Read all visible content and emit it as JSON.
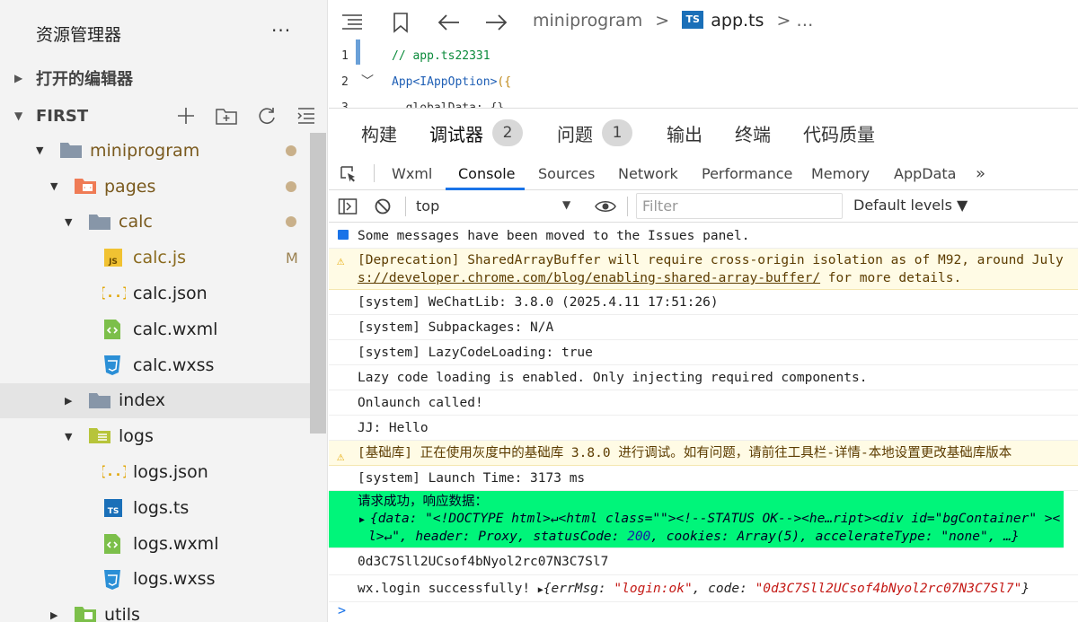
{
  "sidebar": {
    "title": "资源管理器",
    "more": "···",
    "open_editors": "打开的编辑器",
    "project": "FIRST",
    "tree": [
      {
        "name": "miniprogram",
        "type": "folder",
        "marker": "dot"
      },
      {
        "name": "pages",
        "type": "folder-pages",
        "marker": "dot"
      },
      {
        "name": "calc",
        "type": "folder",
        "marker": "dot"
      },
      {
        "name": "calc.js",
        "type": "js",
        "marker": "M"
      },
      {
        "name": "calc.json",
        "type": "json",
        "marker": ""
      },
      {
        "name": "calc.wxml",
        "type": "wxml",
        "marker": ""
      },
      {
        "name": "calc.wxss",
        "type": "wxss",
        "marker": ""
      },
      {
        "name": "index",
        "type": "folder",
        "marker": ""
      },
      {
        "name": "logs",
        "type": "folder-logs",
        "marker": ""
      },
      {
        "name": "logs.json",
        "type": "json",
        "marker": ""
      },
      {
        "name": "logs.ts",
        "type": "ts",
        "marker": ""
      },
      {
        "name": "logs.wxml",
        "type": "wxml",
        "marker": ""
      },
      {
        "name": "logs.wxss",
        "type": "wxss",
        "marker": ""
      },
      {
        "name": "utils",
        "type": "folder-utils",
        "marker": ""
      }
    ]
  },
  "editor": {
    "breadcrumb_folder": "miniprogram",
    "breadcrumb_sep": ">",
    "breadcrumb_file": "app.ts",
    "breadcrumb_more": "> …",
    "ts_badge": "TS",
    "lines": [
      {
        "num": "1",
        "comment": "// app.ts22331"
      },
      {
        "num": "2",
        "kw": "App",
        "type": "<IAppOption>",
        "rest": "({"
      },
      {
        "num": "3",
        "text": "  globalData: {},"
      }
    ]
  },
  "devtools": {
    "panel_tabs": [
      {
        "label": "构建",
        "badge": ""
      },
      {
        "label": "调试器",
        "badge": "2"
      },
      {
        "label": "问题",
        "badge": "1"
      },
      {
        "label": "输出",
        "badge": ""
      },
      {
        "label": "终端",
        "badge": ""
      },
      {
        "label": "代码质量",
        "badge": ""
      }
    ],
    "tool_tabs": [
      "Wxml",
      "Console",
      "Sources",
      "Network",
      "Performance",
      "Memory",
      "AppData"
    ],
    "overflow": "»",
    "context": "top",
    "filter_placeholder": "Filter",
    "levels": "Default levels ▼",
    "console": {
      "msg1": "Some messages have been moved to the Issues panel.",
      "warn1_a": "[Deprecation] SharedArrayBuffer will require cross-origin isolation as of M92, around July",
      "warn1_b_link": "s://developer.chrome.com/blog/enabling-shared-array-buffer/",
      "warn1_b_rest": " for more details.",
      "m2": "[system] WeChatLib: 3.8.0 (2025.4.11 17:51:26)",
      "m3": "[system] Subpackages: N/A",
      "m4": "[system] LazyCodeLoading: true",
      "m5": "Lazy code loading is enabled. Only injecting required components.",
      "m6": "Onlaunch called!",
      "m7": "JJ:  Hello",
      "warn2": "[基础库] 正在使用灰度中的基础库 3.8.0 进行调试。如有问题，请前往工具栏-详情-本地设置更改基础库版本",
      "m8": "[system] Launch Time: 3173 ms",
      "green_title": "请求成功，响应数据：",
      "green_l1": "{data: \"<!DOCTYPE html>↵<html class=\"\"><!--STATUS OK--><he…ript><div id=\"bgContainer\" ><",
      "green_l2_a": "l>↵\", header: Proxy, statusCode: ",
      "green_l2_code": "200",
      "green_l2_b": ", cookies: Array(5), accelerateType: ",
      "green_l2_s": "\"none\"",
      "green_l2_c": ", …}",
      "m9": "0d3C7Sll2UCsof4bNyol2rc07N3C7Sl7",
      "m10_a": "wx.login successfully! ",
      "m10_obj_a": "{errMsg: ",
      "m10_s1": "\"login:ok\"",
      "m10_obj_b": ", code: ",
      "m10_s2": "\"0d3C7Sll2UCsof4bNyol2rc07N3C7Sl7\"",
      "m10_obj_c": "}"
    },
    "prompt": ">"
  }
}
